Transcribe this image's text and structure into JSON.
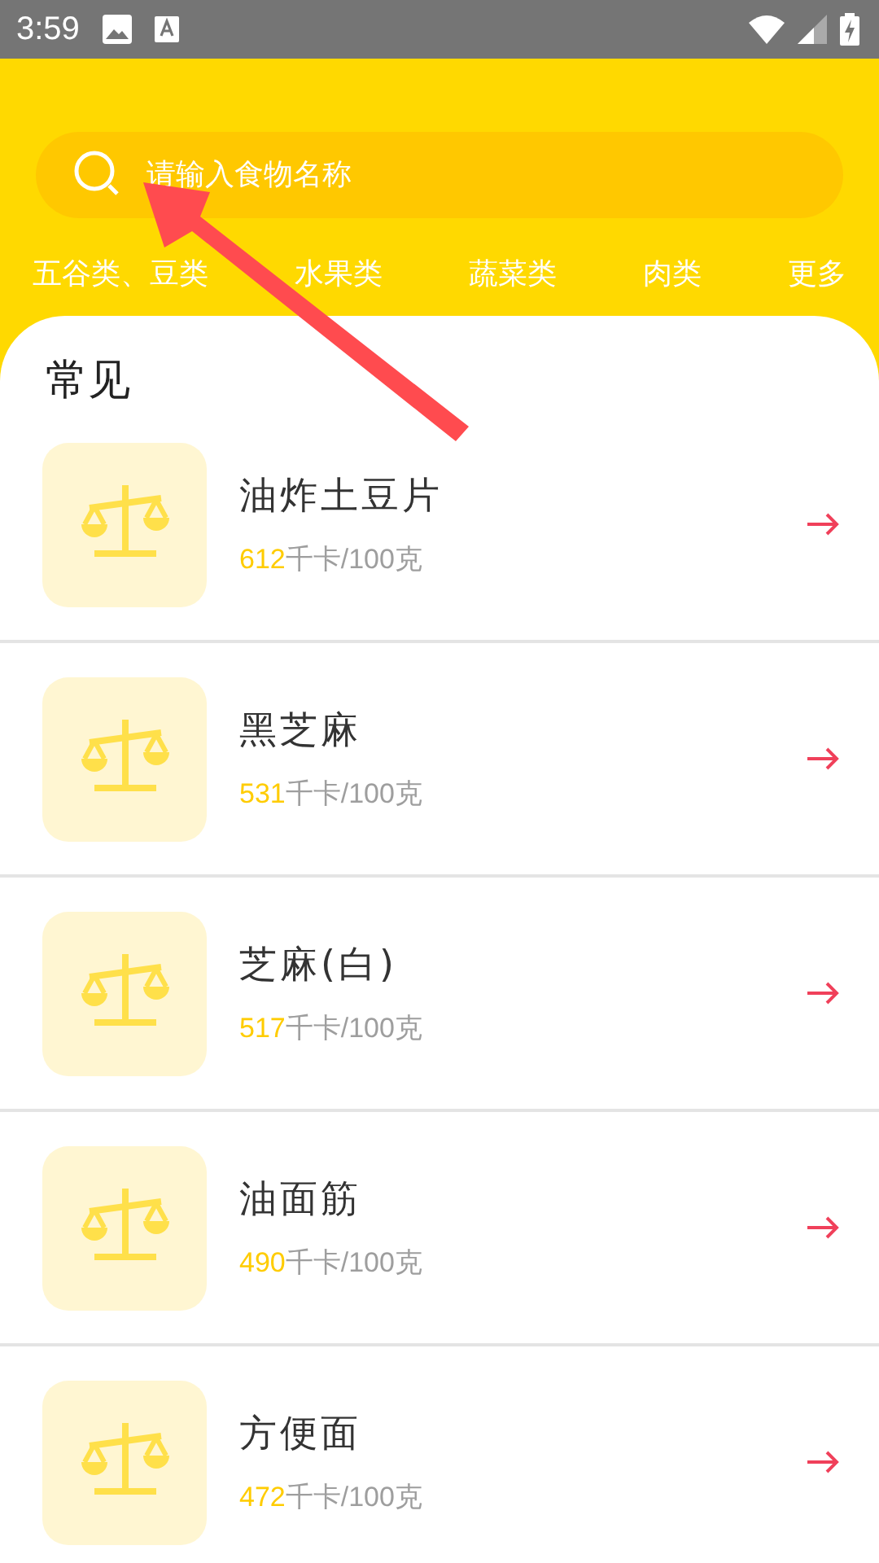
{
  "status_bar": {
    "time": "3:59"
  },
  "search": {
    "placeholder": "请输入食物名称"
  },
  "categories": [
    {
      "label": "五谷类、豆类"
    },
    {
      "label": "水果类"
    },
    {
      "label": "蔬菜类"
    },
    {
      "label": "肉类"
    },
    {
      "label": "更多"
    }
  ],
  "section_title": "常见",
  "foods": [
    {
      "name": "油炸土豆片",
      "kcal": "612",
      "unit": "千卡/100克"
    },
    {
      "name": "黑芝麻",
      "kcal": "531",
      "unit": "千卡/100克"
    },
    {
      "name": "芝麻(白)",
      "kcal": "517",
      "unit": "千卡/100克"
    },
    {
      "name": "油面筋",
      "kcal": "490",
      "unit": "千卡/100克"
    },
    {
      "name": "方便面",
      "kcal": "472",
      "unit": "千卡/100克"
    }
  ]
}
